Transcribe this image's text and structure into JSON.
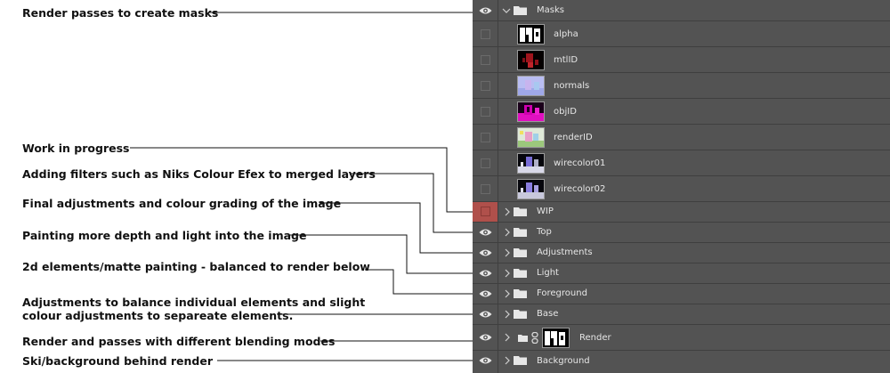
{
  "annotations": [
    {
      "lines": [
        "Render passes to create masks"
      ]
    },
    {
      "lines": [
        "Work in progress"
      ]
    },
    {
      "lines": [
        "Adding filters such as Niks Colour Efex to merged layers"
      ]
    },
    {
      "lines": [
        "Final adjustments and colour grading of the image"
      ]
    },
    {
      "lines": [
        "Painting more depth and light into the image"
      ]
    },
    {
      "lines": [
        "2d elements/matte painting - balanced to render below"
      ]
    },
    {
      "lines": [
        "Adjustments to balance individual elements and slight",
        "colour adjustments to separeate elements."
      ]
    },
    {
      "lines": [
        "Render and passes with different blending modes"
      ]
    },
    {
      "lines": [
        "Ski/background behind render"
      ]
    }
  ],
  "layers": {
    "masks_group": {
      "name": "Masks",
      "visible": true,
      "expanded": true
    },
    "mask_layers": [
      {
        "name": "alpha",
        "visible": false
      },
      {
        "name": "mtlID",
        "visible": false
      },
      {
        "name": "normals",
        "visible": false
      },
      {
        "name": "objID",
        "visible": false
      },
      {
        "name": "renderID",
        "visible": false
      },
      {
        "name": "wirecolor01",
        "visible": false
      },
      {
        "name": "wirecolor02",
        "visible": false
      }
    ],
    "groups": [
      {
        "name": "WIP",
        "visible": false,
        "highlight": "#b0504b"
      },
      {
        "name": "Top",
        "visible": true
      },
      {
        "name": "Adjustments",
        "visible": true
      },
      {
        "name": "Light",
        "visible": true
      },
      {
        "name": "Foreground",
        "visible": true
      },
      {
        "name": "Base",
        "visible": true
      },
      {
        "name": "Render",
        "visible": true,
        "linked": true,
        "has_thumbnail": true
      },
      {
        "name": "Background",
        "visible": true
      }
    ]
  },
  "colors": {
    "panel_bg": "#535353",
    "divider": "#3f3f3f",
    "text": "#e6e6e6",
    "wip_highlight": "#b0504b"
  }
}
